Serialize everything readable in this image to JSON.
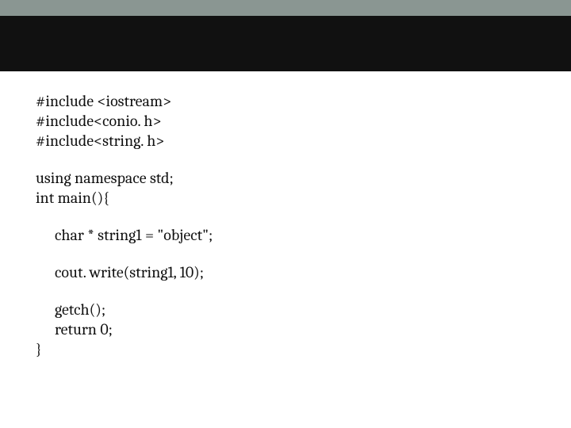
{
  "code": {
    "includes": [
      "#include <iostream>",
      "#include<conio. h>",
      "#include<string. h>"
    ],
    "decl1": "using namespace std;",
    "decl2": "int main(){",
    "stmt1": "char * string1 = \"object\";",
    "stmt2": "cout. write(string1, 10);",
    "stmt3": "getch();",
    "stmt4": "return 0;",
    "close": "}"
  }
}
